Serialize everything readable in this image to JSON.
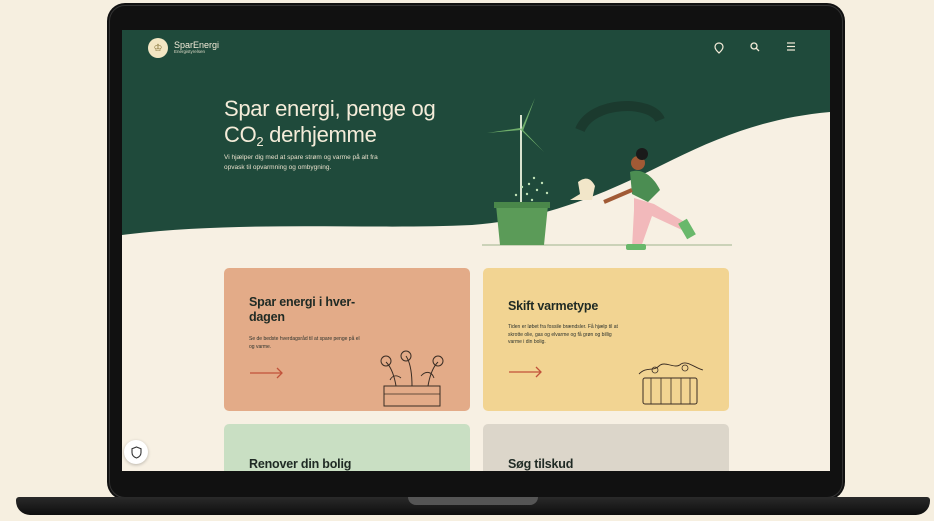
{
  "brand": {
    "name": "SparEnergi",
    "sub": "Energistyrelsen"
  },
  "hero": {
    "title_line1": "Spar energi, penge og",
    "title_co": "CO",
    "title_sub": "2",
    "title_rest": " derhjemme",
    "description": "Vi hjælper dig med at spare strøm og varme på alt fra opvask til opvarmning og ombygning."
  },
  "cards": [
    {
      "title": "Spar energi i hver-dagen",
      "desc": "Se de bedste hverdagsråd til at spare penge på el og varme."
    },
    {
      "title": "Skift varmetype",
      "desc": "Tiden er løbet fra fossile brændsler. Få hjælp til at skrotte olie, gas og elvarme og få grøn og billig varme i din bolig."
    },
    {
      "title": "Renover din bolig",
      "desc": ""
    },
    {
      "title": "Søg tilskud",
      "desc": ""
    }
  ],
  "icons": [
    "location-icon",
    "search-icon",
    "menu-icon",
    "shield-icon",
    "arrow-right-icon"
  ],
  "colors": {
    "hero_green": "#1f4a3b",
    "cream": "#f7f0e3",
    "card_orange": "#e3ab88",
    "card_yellow": "#f2d492",
    "card_green": "#c9dfc3",
    "card_gray": "#dcd6ca"
  }
}
